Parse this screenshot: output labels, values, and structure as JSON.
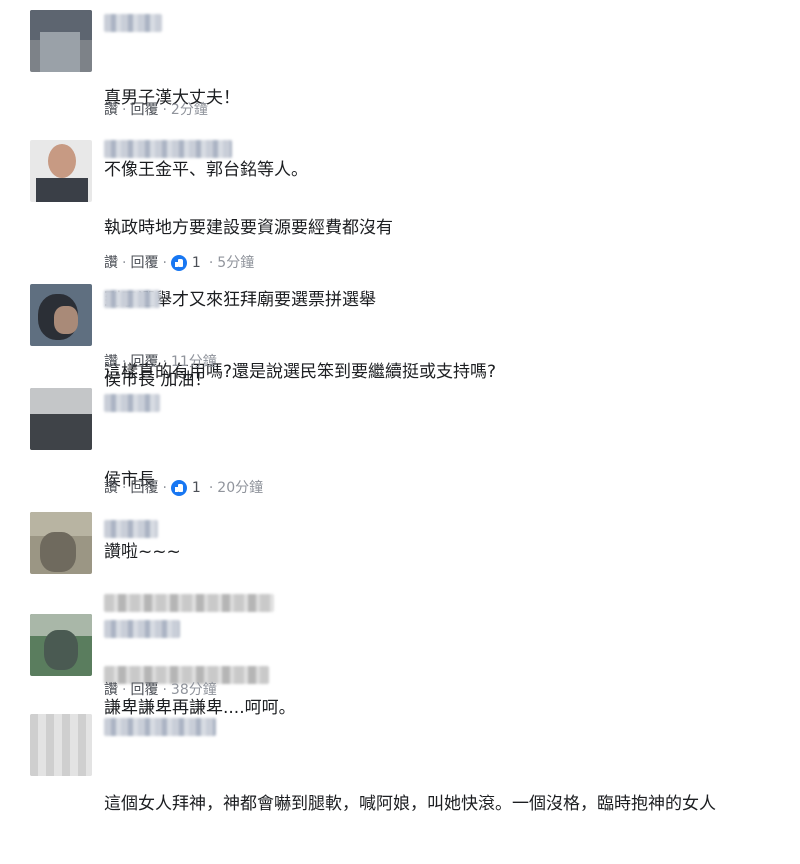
{
  "actions": {
    "like": "讚",
    "reply": "回覆",
    "separator": "·"
  },
  "comments": [
    {
      "lines": [
        "真男子漢大丈夫！",
        "不像王金平、郭台銘等人。"
      ],
      "likes": null,
      "time": "2分鐘"
    },
    {
      "lines": [
        "執政時地方要建設要資源要經費都沒有",
        "到了選舉才又來狂拜廟要選票拼選舉",
        "這樣真的有用嗎?還是說選民笨到要繼續挺或支持嗎?"
      ],
      "likes": "1",
      "time": "5分鐘"
    },
    {
      "lines": [
        "侯市長 加油！"
      ],
      "likes": null,
      "time": "11分鐘"
    },
    {
      "lines": [
        "侯市長",
        "讚啦~~~"
      ],
      "likes": "1",
      "time": "20分鐘"
    },
    {
      "lines": [],
      "likes": null,
      "time": ""
    },
    {
      "lines": [
        "謙卑謙卑再謙卑....呵呵。"
      ],
      "likes": null,
      "time": "38分鐘"
    },
    {
      "lines": [
        "這個女人拜神，神都會嚇到腿軟，喊阿娘，叫她快滾。一個沒格，臨時抱神的女人"
      ],
      "likes": null,
      "time": ""
    }
  ],
  "colors": {
    "like_blue": "#1877f2",
    "text": "#1c1e21",
    "meta": "#90949c"
  },
  "icons": {
    "like": "thumbs-up-icon"
  }
}
